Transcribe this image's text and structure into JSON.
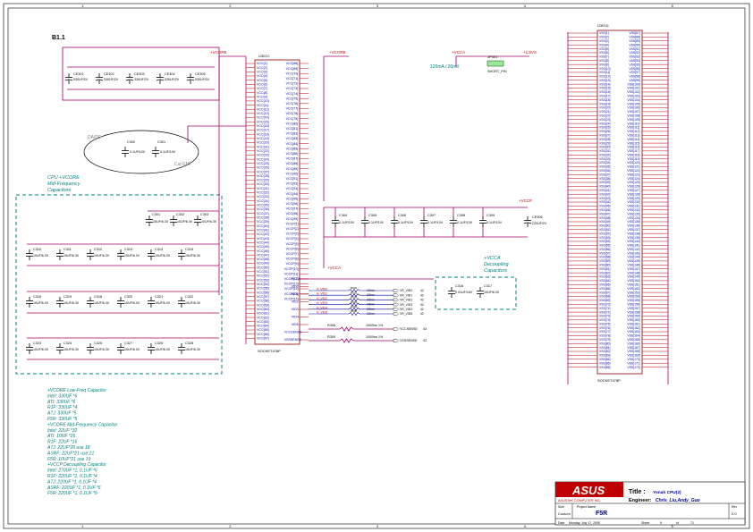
{
  "sheet": {
    "rev_block": "B1.1",
    "zone_columns": [
      "1",
      "2",
      "3",
      "4",
      "5"
    ]
  },
  "nets": {
    "vcore_left": "+VCORE",
    "vcore_mid": "+VCORE",
    "vcca": "+VCCA",
    "v15": "+1.5VS",
    "vccp": "+VCCP",
    "vcca2": "+VCCA"
  },
  "bulk_caps": [
    {
      "ref": "CE301",
      "val": "330UF/2V"
    },
    {
      "ref": "CE302",
      "val": "330UF/2V"
    },
    {
      "ref": "CE303",
      "val": "330UF/2V"
    },
    {
      "ref": "CE304",
      "val": "330UF/2V"
    },
    {
      "ref": "CE305",
      "val": "330UF/2V"
    }
  ],
  "ellipse_caps": [
    {
      "ref": "C300",
      "val": "0.1UF/10V"
    },
    {
      "ref": "C301",
      "val": "0.1UF/10V"
    }
  ],
  "ellipse_labels": {
    "top": "DA/DE",
    "bottom": "Cut EMI"
  },
  "cpu_note": {
    "l1": "CPU +VCORE",
    "l2": "Mid-Frequency",
    "l3": "Capacitors"
  },
  "mid_caps_top": [
    {
      "ref": "C301",
      "val": "10UF/6.3V"
    },
    {
      "ref": "C302",
      "val": "10UF/6.3V"
    },
    {
      "ref": "C303",
      "val": "10UF/6.3V"
    }
  ],
  "mid_caps_rows": [
    [
      {
        "ref": "C310",
        "val": "10UF/6.3V"
      },
      {
        "ref": "C311",
        "val": "10UF/6.3V"
      },
      {
        "ref": "C312",
        "val": "10UF/6.3V"
      },
      {
        "ref": "C313",
        "val": "10UF/6.3V"
      },
      {
        "ref": "C314",
        "val": "10UF/6.3V"
      },
      {
        "ref": "C315",
        "val": "10UF/6.3V"
      }
    ],
    [
      {
        "ref": "C316",
        "val": "10UF/6.3V"
      },
      {
        "ref": "C319",
        "val": "10UF/6.3V"
      },
      {
        "ref": "C318",
        "val": "10UF/6.3V"
      },
      {
        "ref": "C320",
        "val": "10UF/6.3V"
      },
      {
        "ref": "C321",
        "val": "10UF/6.3V"
      },
      {
        "ref": "C322",
        "val": "10UF/6.3V"
      }
    ],
    [
      {
        "ref": "C323",
        "val": "10UF/6.3V"
      },
      {
        "ref": "C324",
        "val": "10UF/6.3V"
      },
      {
        "ref": "C325",
        "val": "10UF/6.3V"
      },
      {
        "ref": "C327",
        "val": "10UF/6.3V"
      },
      {
        "ref": "C326",
        "val": "10UF/6.3V"
      },
      {
        "ref": "C328",
        "val": "10UF/6.3V"
      }
    ]
  ],
  "cap_notes": [
    "+VCORE Low-Freq Capacitor",
    " Intel: 330UF *6",
    "ATI: 330UF *6",
    " R1F: 330UF *4",
    " A7J: 330UF *5",
    "  F5R: 330UF *5",
    "+VCORE Mid-Frequency Capacitor",
    "  Intel: 22UF *32",
    "ATI: 10UF *26",
    " R1F: 22UF *16",
    " A7J: 22UF*20 use 18",
    "ASRF: 22UF*21 use 21",
    "  F5R: 10UF*21 use 19",
    "+VCCP Decoupling Capacitor",
    " Intel: 270UF *1, 0.1UF *6",
    " R1F: 220UF *1, 0.1UF *4",
    " A7J: 220UF *1, 0.1UF *4",
    "ASRF: 220UF *1, 0.1UF *6",
    " F5R: 220UF *1, 0.1UF *6"
  ],
  "u301c": {
    "ref": "U301C",
    "part": "SOCKET478P",
    "left_pins": [
      "VCC[1]",
      "VCC[2]",
      "VCC[3]",
      "VCC[4]",
      "VCC[5]",
      "VCC[6]",
      "VCC[7]",
      "VCC[8]",
      "VCC[9]",
      "VCC[10]",
      "VCC[11]",
      "VCC[12]",
      "VCC[13]",
      "VCC[14]",
      "VCC[15]",
      "VCC[16]",
      "VCC[17]",
      "VCC[18]",
      "VCC[19]",
      "VCC[20]",
      "VCC[21]",
      "VCC[22]",
      "VCC[23]",
      "VCC[24]",
      "VCC[25]",
      "VCC[26]",
      "VCC[27]",
      "VCC[28]",
      "VCC[29]",
      "VCC[30]",
      "VCC[31]",
      "VCC[32]",
      "VCC[33]",
      "VCC[34]",
      "VCC[35]",
      "VCC[36]",
      "VCC[37]",
      "VCC[38]",
      "VCC[39]",
      "VCC[40]",
      "VCC[41]",
      "VCC[42]",
      "VCC[43]",
      "VCC[44]",
      "VCC[45]",
      "VCC[46]",
      "VCC[47]",
      "VCC[48]",
      "VCC[49]",
      "VCC[50]",
      "VCC[51]",
      "VCC[52]",
      "VCC[53]",
      "VCC[54]",
      "VCC[55]",
      "VCC[56]",
      "VCC[57]",
      "VCC[58]",
      "VCC[59]",
      "VCC[60]",
      "VCC[61]",
      "VCC[62]",
      "VCC[63]",
      "VCC[64]",
      "VCC[65]",
      "VCC[66]",
      "VCC[67]"
    ],
    "right_top": [
      "VCC[68]",
      "VCC[69]",
      "VCC[70]",
      "VCC[71]",
      "VCC[72]",
      "VCC[73]",
      "VCC[74]",
      "VCC[75]",
      "VCC[76]",
      "VCC[77]",
      "VCC[78]",
      "VCC[79]",
      "VCC[80]",
      "VCC[81]",
      "VCC[82]",
      "VCC[83]",
      "VCC[84]",
      "VCC[85]",
      "VCC[86]",
      "VCC[87]",
      "VCC[88]",
      "VCC[89]",
      "VCC[90]",
      "VCC[91]",
      "VCC[92]",
      "VCC[93]",
      "VCC[94]",
      "VCC[95]",
      "VCC[96]",
      "VCC[97]",
      "VCC[98]",
      "VCC[99]"
    ],
    "right_vccp": [
      "VCCP[1]",
      "VCCP[2]",
      "VCCP[3]",
      "VCCP[4]",
      "VCCP[5]",
      "VCCP[6]",
      "VCCP[7]",
      "VCCP[8]",
      "VCCP[9]",
      "VCCP[10]",
      "VCCP[11]",
      "VCCP[12]",
      "VCCP[13]",
      "VCCP[14]",
      "VCCP[15]",
      "VCCP[16]"
    ],
    "right_vid": [
      "VCCA",
      "VID0",
      "VID1",
      "VID2",
      "VID3",
      "VID4",
      "VID5",
      "VCCSENSE",
      "VSSSENSE"
    ]
  },
  "vid_nets": [
    "H_VID0",
    "H_VID1",
    "H_VID2",
    "H_VID3",
    "H_VID4",
    "H_VID5"
  ],
  "vid_resistors": [
    "R301",
    "R302",
    "R303",
    "R304",
    "R305",
    "R306"
  ],
  "vid_out": [
    "VR_VID0",
    "VR_VID1",
    "VR_VID2",
    "VR_VID3",
    "VR_VID4",
    "VR_VID5"
  ],
  "vid_page": "42",
  "vid_res_val": "0Ohm",
  "sense": [
    {
      "ref": "R308",
      "val": "1000hm 1%",
      "net": "VCCSENSE",
      "page": "43"
    },
    {
      "ref": "R309",
      "val": "1000hm 1%",
      "net": "VSSSENSE",
      "page": "43"
    }
  ],
  "jumper": {
    "ref": "JP301",
    "type": "SHORT_PIN",
    "current": "120mA / 20mil"
  },
  "vccp_caps": [
    {
      "ref": "C304",
      "val": "0.1UF/10V"
    },
    {
      "ref": "C305",
      "val": "0.1UF/10V"
    },
    {
      "ref": "C306",
      "val": "0.1UF/10V"
    },
    {
      "ref": "C307",
      "val": "0.1UF/10V"
    },
    {
      "ref": "C308",
      "val": "0.1UF/10V"
    },
    {
      "ref": "C309",
      "val": "0.1UF/10V"
    }
  ],
  "vccp_bulk": {
    "ref": "CE306",
    "val": "220UF/2V"
  },
  "vcca_note": {
    "l1": "+VCCA",
    "l2": "Decoupling",
    "l3": "Capacitors"
  },
  "vcca_caps": [
    {
      "ref": "C316",
      "val": "0.01UF/16V"
    },
    {
      "ref": "C317",
      "val": "10UF/6.3V"
    }
  ],
  "u301d": {
    "ref": "U301D",
    "part": "SOCKET478P",
    "left_pins": [
      "VSS[1]",
      "VSS[2]",
      "VSS[3]",
      "VSS[4]",
      "VSS[5]",
      "VSS[6]",
      "VSS[7]",
      "VSS[8]",
      "VSS[9]",
      "VSS[10]",
      "VSS[11]",
      "VSS[12]",
      "VSS[13]",
      "VSS[14]",
      "VSS[15]",
      "VSS[16]",
      "VSS[17]",
      "VSS[18]",
      "VSS[19]",
      "VSS[20]",
      "VSS[21]",
      "VSS[22]",
      "VSS[23]",
      "VSS[24]",
      "VSS[25]",
      "VSS[26]",
      "VSS[27]",
      "VSS[28]",
      "VSS[29]",
      "VSS[30]",
      "VSS[31]",
      "VSS[32]",
      "VSS[33]",
      "VSS[34]",
      "VSS[35]",
      "VSS[36]",
      "VSS[37]",
      "VSS[38]",
      "VSS[39]",
      "VSS[40]",
      "VSS[41]",
      "VSS[42]",
      "VSS[43]",
      "VSS[44]",
      "VSS[45]",
      "VSS[46]",
      "VSS[47]",
      "VSS[48]",
      "VSS[49]",
      "VSS[50]",
      "VSS[51]",
      "VSS[52]",
      "VSS[53]",
      "VSS[54]",
      "VSS[55]",
      "VSS[56]",
      "VSS[57]",
      "VSS[58]",
      "VSS[59]",
      "VSS[60]",
      "VSS[61]",
      "VSS[62]",
      "VSS[63]",
      "VSS[64]",
      "VSS[65]",
      "VSS[66]",
      "VSS[67]",
      "VSS[68]",
      "VSS[69]",
      "VSS[70]",
      "VSS[71]",
      "VSS[72]",
      "VSS[73]",
      "VSS[74]",
      "VSS[75]",
      "VSS[76]",
      "VSS[77]",
      "VSS[78]",
      "VSS[79]",
      "VSS[80]",
      "VSS[81]",
      "VSS[82]",
      "VSS[83]",
      "VSS[84]",
      "VSS[85]",
      "VSS[86]"
    ],
    "right_pins": [
      "VSS[87]",
      "VSS[88]",
      "VSS[89]",
      "VSS[90]",
      "VSS[91]",
      "VSS[92]",
      "VSS[93]",
      "VSS[94]",
      "VSS[95]",
      "VSS[96]",
      "VSS[97]",
      "VSS[98]",
      "VSS[99]",
      "VSS[100]",
      "VSS[101]",
      "VSS[102]",
      "VSS[103]",
      "VSS[104]",
      "VSS[105]",
      "VSS[106]",
      "VSS[107]",
      "VSS[108]",
      "VSS[109]",
      "VSS[110]",
      "VSS[111]",
      "VSS[112]",
      "VSS[113]",
      "VSS[114]",
      "VSS[115]",
      "VSS[116]",
      "VSS[117]",
      "VSS[118]",
      "VSS[119]",
      "VSS[120]",
      "VSS[121]",
      "VSS[122]",
      "VSS[123]",
      "VSS[124]",
      "VSS[125]",
      "VSS[126]",
      "VSS[127]",
      "VSS[128]",
      "VSS[129]",
      "VSS[130]",
      "VSS[131]",
      "VSS[132]",
      "VSS[133]",
      "VSS[134]",
      "VSS[135]",
      "VSS[136]",
      "VSS[137]",
      "VSS[138]",
      "VSS[139]",
      "VSS[140]",
      "VSS[141]",
      "VSS[142]",
      "VSS[143]",
      "VSS[144]",
      "VSS[145]",
      "VSS[146]",
      "VSS[147]",
      "VSS[148]",
      "VSS[149]",
      "VSS[150]",
      "VSS[151]",
      "VSS[152]",
      "VSS[153]",
      "VSS[154]",
      "VSS[155]",
      "VSS[156]",
      "VSS[157]",
      "VSS[158]",
      "VSS[159]",
      "VSS[160]",
      "VSS[161]",
      "VSS[162]",
      "VSS[163]",
      "VSS[164]",
      "VSS[165]",
      "VSS[166]",
      "VSS[167]",
      "VSS[168]",
      "VSS[169]",
      "VSS[170]",
      "VSS[171]",
      "VSS[172]"
    ]
  },
  "titleblock": {
    "logo": "ASUS",
    "company": "ASUSTeK COMPUTER INC.",
    "title_label": "Title :",
    "title": "Yonah CPU(2)",
    "engineer_label": "Engineer:",
    "engineer": "Chris_Liu,Andy_Guo",
    "size_label": "Size",
    "project_label": "Project Name",
    "rev_label": "Rev",
    "project": "F5R",
    "rev": "2.0",
    "custom": "Custom",
    "date_label": "Date",
    "date": "Monday, July 17, 2006",
    "sheet_label": "Sheet",
    "sheet": "9",
    "of_label": "of",
    "total": "71"
  },
  "colors": {
    "wire": "#a0006a",
    "box": "#8b0000",
    "note": "#008080",
    "label": "#0000a0"
  }
}
